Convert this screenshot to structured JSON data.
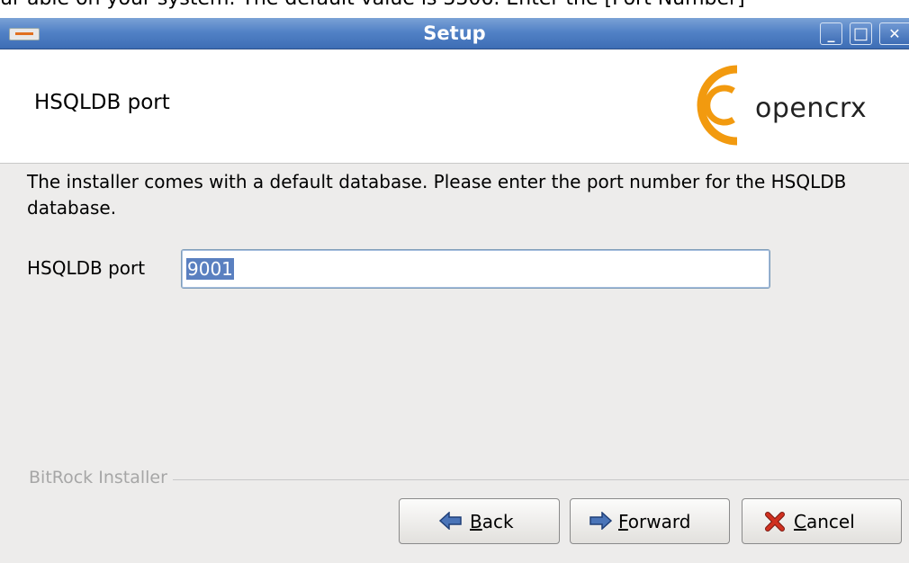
{
  "background_text": "ur able on your system. The default value is 3306. Enter the [Port Number]",
  "window": {
    "title": "Setup",
    "buttons": {
      "minimize": "_",
      "maximize": "□",
      "close": "✕"
    }
  },
  "header": {
    "title": "HSQLDB port",
    "logo_text": "opencrx",
    "logo_color": "#f29a0f"
  },
  "body": {
    "description": "The installer comes with a default database. Please enter the port number for the HSQLDB database.",
    "port_field": {
      "label": "HSQLDB port",
      "value": "9001"
    }
  },
  "footer": {
    "brand": "BitRock Installer",
    "back": {
      "mnemonic": "B",
      "rest": "ack"
    },
    "forward": {
      "mnemonic": "F",
      "rest": "orward"
    },
    "cancel": {
      "mnemonic": "C",
      "rest": "ancel"
    }
  },
  "colors": {
    "titlebar": "#4f7fc4",
    "arrow": "#4a74b8",
    "cancel_x": "#d03020",
    "selection": "#5a80c0"
  },
  "icons": {
    "back": "arrow-left-icon",
    "forward": "arrow-right-icon",
    "cancel": "red-x-icon"
  }
}
